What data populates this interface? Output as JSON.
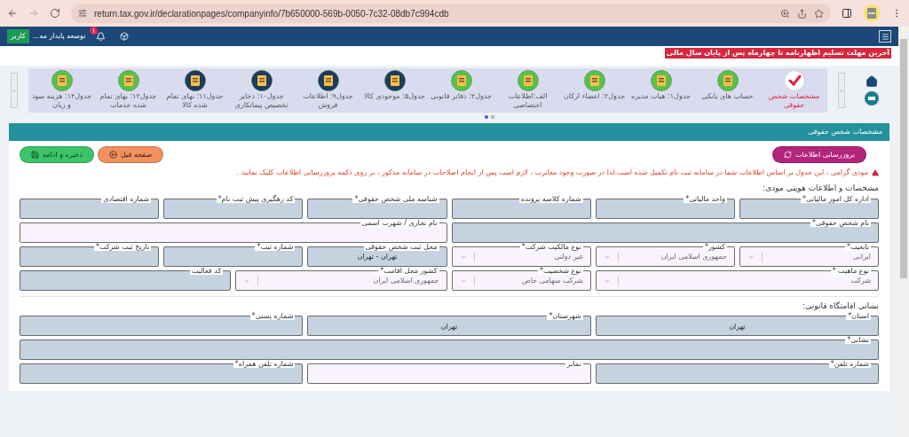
{
  "browser": {
    "url": "return.tax.gov.ir/declarationpages/companyinfo/7b650000-569b-0050-7c32-08db7c994cdb"
  },
  "navbar": {
    "user_badge": "کاربر",
    "company": "توسعه پایدار مه...",
    "notification_count": "۱"
  },
  "announcement": "آخرین مهلت تسلیم اظهارنامه تا چهارماه پس از پایان سال مالی",
  "steps": [
    {
      "label": "مشخصات شخص حقوقی",
      "selected": true,
      "color": "#ffffff"
    },
    {
      "label": "حساب های بانکی",
      "selected": false,
      "color": "#5cbf4a"
    },
    {
      "label": "جدول۱: هیات مدیره",
      "selected": false,
      "color": "#5cbf4a"
    },
    {
      "label": "جدول۲: اعضاء ارکان",
      "selected": false,
      "color": "#5cbf4a"
    },
    {
      "label": "الف:اطلاعات اختصاصی",
      "selected": false,
      "color": "#5cbf4a"
    },
    {
      "label": "جدول۴: دفاتر قانونی",
      "selected": false,
      "color": "#5cbf4a"
    },
    {
      "label": "جدول۵: موجودی کالا",
      "selected": false,
      "color": "#1f3b5e"
    },
    {
      "label": "جدول۹: اطلاعات فروش",
      "selected": false,
      "color": "#1f3b5e"
    },
    {
      "label": "جدول۱۰: ذخایر تخصیص پیمانکاری",
      "selected": false,
      "color": "#1f3b5e"
    },
    {
      "label": "جدول۱۱: بهای تمام شده کالا",
      "selected": false,
      "color": "#1f3b5e"
    },
    {
      "label": "جدول۱۲: بهای تمام شده خدمات",
      "selected": false,
      "color": "#5cbf4a"
    },
    {
      "label": "جدول۱۴: هزینه سود و زیان",
      "selected": false,
      "color": "#5cbf4a"
    }
  ],
  "pager_dots": [
    {
      "selected": false
    },
    {
      "selected": true
    }
  ],
  "card": {
    "title": "مشخصات شخص حقوقی",
    "buttons": [
      {
        "kind": "refresh",
        "label": "بروزرسانی اطلاعات"
      },
      {
        "kind": "back",
        "label": "صفحه قبل"
      },
      {
        "kind": "save",
        "label": "ذخیره و ادامه"
      }
    ],
    "warning": "مودی گرامی ، این جدول بر اساس اطلاعات شما در سامانه ثبت نام تکمیل شده است.لذا در صورت وجود مغایرت ، لازم است پس از انجام اصلاحات در سامانه مذکور ، بر روی دکمه بروزرسانی اطلاعات کلیک نمایید ."
  },
  "identity": {
    "title": "مشخصات و اطلاعات هویتی مودی:",
    "fields": [
      {
        "kind": "text",
        "label": "اداره کل امور مالیاتی*",
        "disabled": true
      },
      {
        "kind": "text",
        "label": "واحد مالیاتی*",
        "disabled": true
      },
      {
        "kind": "text",
        "label": "شماره کلاسه پرونده",
        "disabled": true
      },
      {
        "kind": "text",
        "label": "شناسه ملی شخص حقوقی*",
        "disabled": true
      },
      {
        "kind": "text",
        "label": "کد رهگیری پیش ثبت نام*",
        "disabled": true
      },
      {
        "kind": "text",
        "label": "شماره اقتصادی",
        "disabled": true
      },
      {
        "kind": "text",
        "label": "نام شخص حقوقی*",
        "disabled": true
      },
      {
        "kind": "text",
        "label": "نام تجاری / شهرت اسمی",
        "disabled": false
      },
      {
        "kind": "select",
        "label": "تابعیت*",
        "value": "ایرانی",
        "disabled": false
      },
      {
        "kind": "select",
        "label": "کشور*",
        "value": "جمهوری اسلامی ایران",
        "disabled": false
      },
      {
        "kind": "select",
        "label": "نوع مالکیت شرکت*",
        "value": "غیر دولتی",
        "disabled": false
      },
      {
        "kind": "text",
        "label": "محل ثبت شخص حقوقی",
        "value": "تهران - تهران",
        "disabled": true
      },
      {
        "kind": "text",
        "label": "شماره ثبت*",
        "disabled": true
      },
      {
        "kind": "text",
        "label": "تاریخ ثبت شرکت*",
        "disabled": true
      },
      {
        "kind": "select",
        "label": "نوع ماهیت *",
        "value": "شرکت",
        "disabled": false
      },
      {
        "kind": "select",
        "label": "نوع شخصیت*",
        "value": "شرکت سهامی خاص",
        "disabled": false
      },
      {
        "kind": "select",
        "label": "کشور محل اقامت*",
        "value": "جمهوری اسلامی ایران",
        "disabled": false
      },
      {
        "kind": "text",
        "label": "کد فعالیت",
        "disabled": true
      }
    ]
  },
  "address": {
    "title": "نشانی اقامتگاه قانونی:",
    "fields": [
      {
        "kind": "text",
        "label": "استان*",
        "value": "تهران",
        "disabled": true
      },
      {
        "kind": "text",
        "label": "شهرستان*",
        "value": "تهران",
        "disabled": true
      },
      {
        "kind": "text",
        "label": "شماره پستی*",
        "disabled": true
      },
      {
        "kind": "text",
        "label": "نشانی*",
        "disabled": true
      },
      {
        "kind": "text",
        "label": "شماره تلفن*",
        "disabled": true
      },
      {
        "kind": "text",
        "label": "نمابر",
        "disabled": false
      },
      {
        "kind": "text",
        "label": "شماره تلفن همراه*",
        "disabled": true
      }
    ]
  }
}
